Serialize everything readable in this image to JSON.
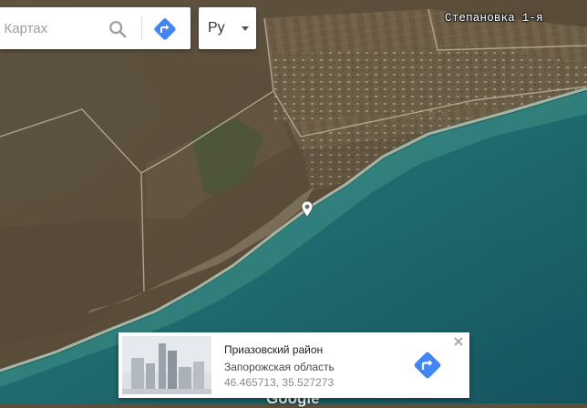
{
  "search": {
    "placeholder": "е Картах",
    "search_icon": "search-icon",
    "directions_icon": "directions-icon"
  },
  "language": {
    "selected": "Ру",
    "caret_icon": "caret-down-icon"
  },
  "map": {
    "view": "satellite",
    "place_labels": [
      "Степановка 1-я"
    ],
    "marker_icon": "place-marker-icon",
    "colors": {
      "sea": "#1f6d70",
      "land": "#5b4f3d",
      "beach": "#c9bfa4"
    }
  },
  "watermark": {
    "text": "Google"
  },
  "info_card": {
    "title": "Приазовский район",
    "subtitle": "Запорожская область",
    "coordinates": "46.465713, 35.527273",
    "thumbnail_icon": "street-view-thumbnail",
    "directions_icon": "directions-icon",
    "close_icon": "close-icon",
    "accent_color": "#4285f4"
  }
}
